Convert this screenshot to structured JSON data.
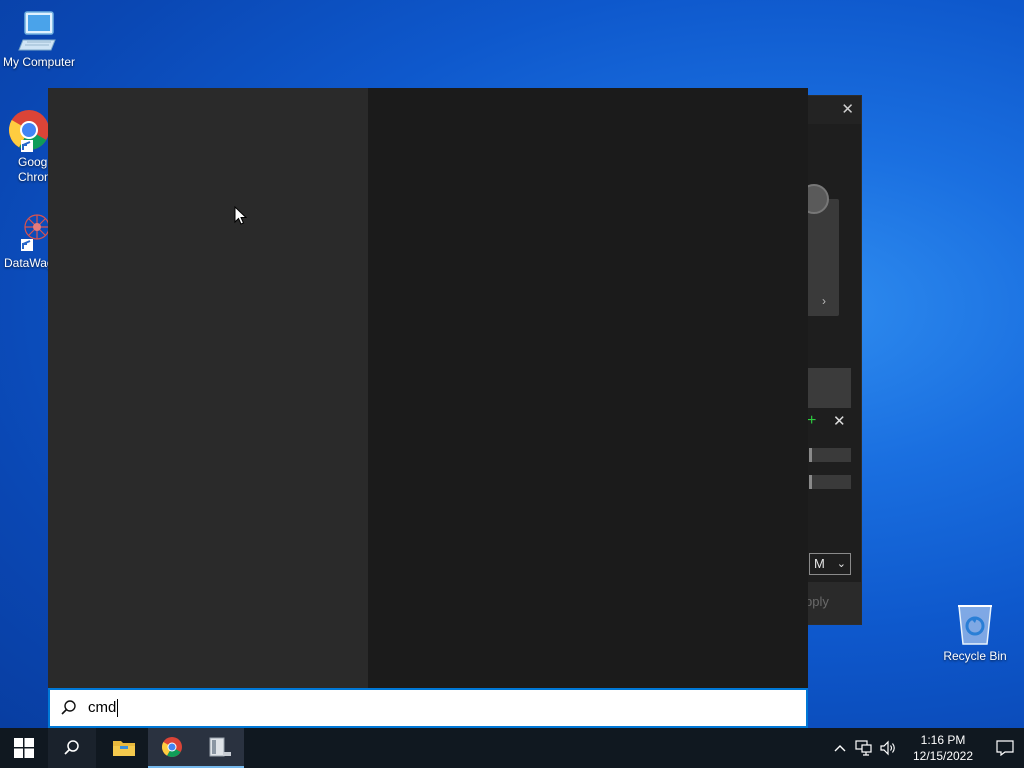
{
  "desktop": {
    "icons": [
      {
        "label": "My Computer"
      },
      {
        "label": "Goog Chron"
      },
      {
        "label": "DataWag"
      },
      {
        "label": "Recycle Bin"
      }
    ]
  },
  "background_window": {
    "select_value": "M",
    "apply_label": "pply"
  },
  "search": {
    "query": "cmd"
  },
  "taskbar": {
    "time": "1:16 PM",
    "date": "12/15/2022"
  },
  "colors": {
    "accent": "#0078d7",
    "start_left_bg": "#2a2a2a",
    "start_right_bg": "#1b1b1b",
    "taskbar_bg": "#101820"
  }
}
